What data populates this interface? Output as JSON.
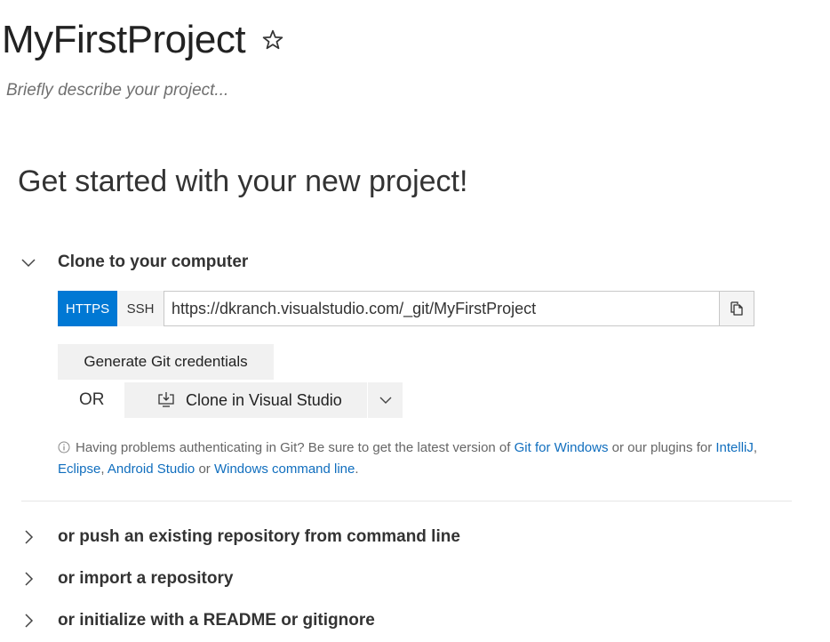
{
  "project": {
    "title": "MyFirstProject",
    "description_placeholder": "Briefly describe your project..."
  },
  "heading": "Get started with your new project!",
  "clone_section": {
    "label": "Clone to your computer",
    "expanded": true,
    "protocols": [
      "HTTPS",
      "SSH"
    ],
    "selected_protocol": "HTTPS",
    "url": "https://dkranch.visualstudio.com/_git/MyFirstProject",
    "generate_credentials_label": "Generate Git credentials",
    "or_label": "OR",
    "clone_vs_label": "Clone in Visual Studio",
    "help": {
      "prefix": "Having problems authenticating in Git? Be sure to get the latest version of ",
      "git_for_windows": "Git for Windows",
      "middle": " or our plugins for ",
      "intellij": "IntelliJ",
      "comma": ",",
      "eclipse": "Eclipse",
      "comma2": ", ",
      "android_studio": "Android Studio",
      "or": " or ",
      "windows_cmd": "Windows command line",
      "period": "."
    }
  },
  "collapsed_sections": [
    {
      "label": "or push an existing repository from command line"
    },
    {
      "label": "or import a repository"
    },
    {
      "label": "or initialize with a README or gitignore"
    }
  ],
  "colors": {
    "accent": "#0078d4",
    "link": "#106ebe"
  }
}
